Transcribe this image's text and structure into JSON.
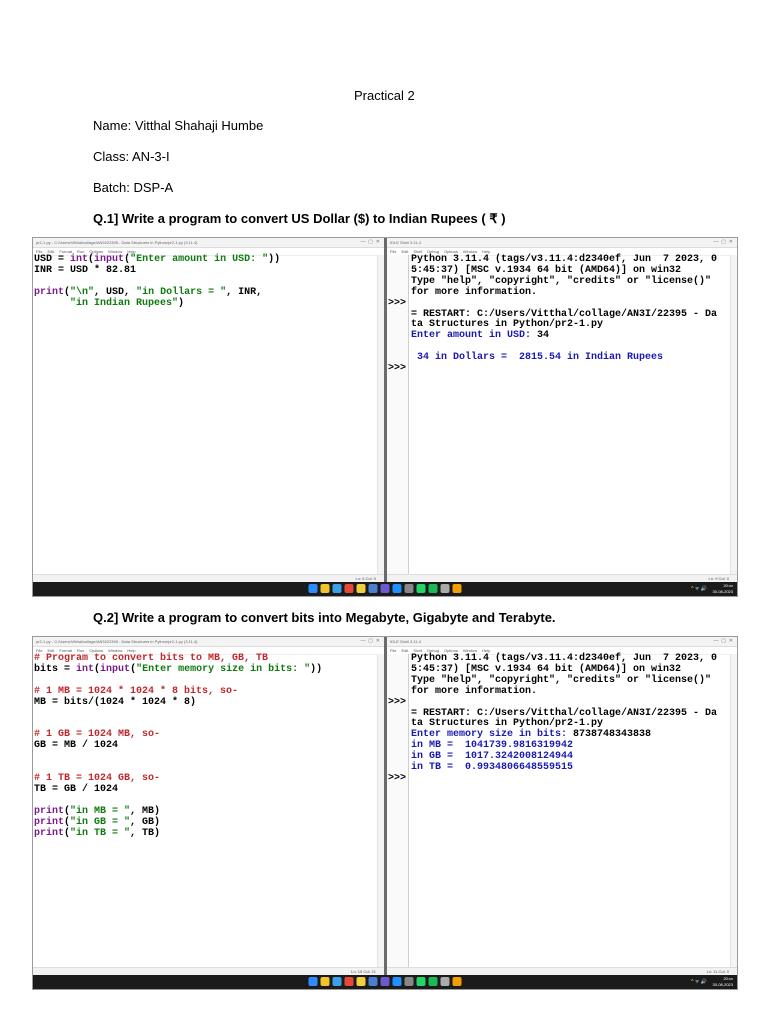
{
  "header": {
    "title": "Practical 2",
    "name_line": "Name: Vitthal Shahaji Humbe",
    "class_line": "Class: AN-3-I",
    "batch_line": "Batch: DSP-A"
  },
  "questions": [
    {
      "heading": "Q.1] Write a program to convert US Dollar ($) to Indian Rupees ( ₹ )",
      "editor": {
        "title": "pr2-1.py - C:/Users/Vitthal/collage/AN3I/22395 - Data Structures in Python/pr2-1.py (3.11.4)",
        "menu": [
          "File",
          "Edit",
          "Format",
          "Run",
          "Options",
          "Window",
          "Help"
        ],
        "status": "Ln: 6   Col: 0",
        "code": [
          "USD = int(input(\"Enter amount in USD: \"))",
          "INR = USD * 82.81",
          "",
          "print(\"\\n\", USD, \"in Dollars = \", INR,",
          "      \"in Indian Rupees\")"
        ]
      },
      "shell": {
        "title": "IDLE Shell 3.11.4",
        "menu": [
          "File",
          "Edit",
          "Shell",
          "Debug",
          "Options",
          "Window",
          "Help"
        ],
        "status": "Ln: 9   Col: 0",
        "gutter": [
          "",
          "",
          "",
          "",
          ">>>",
          "",
          "",
          "",
          "",
          "",
          ">>>"
        ],
        "info": [
          "Python 3.11.4 (tags/v3.11.4:d2340ef, Jun  7 2023, 0",
          "5:45:37) [MSC v.1934 64 bit (AMD64)] on win32",
          "Type \"help\", \"copyright\", \"credits\" or \"license()\"",
          "for more information."
        ],
        "restart": [
          "= RESTART: C:/Users/Vitthal/collage/AN3I/22395 - Da",
          "ta Structures in Python/pr2-1.py"
        ],
        "prompt": "Enter amount in USD: ",
        "input_value": "34",
        "output": " 34 in Dollars =  2815.54 in Indian Rupees"
      },
      "tray": {
        "lang": "ENG\nIN",
        "time": "20:xx\n30-08-2023"
      }
    },
    {
      "heading": "Q.2] Write a program to convert bits into Megabyte, Gigabyte and Terabyte.",
      "editor": {
        "title": "pr2-1.py - C:/Users/Vitthal/collage/AN3I/22395 - Data Structures in Python/pr2-1.py (3.11.4)",
        "menu": [
          "File",
          "Edit",
          "Format",
          "Run",
          "Options",
          "Window",
          "Help"
        ],
        "status": "Ln: 15   Col: 21",
        "code": [
          "# Program to convert bits to MB, GB, TB",
          "bits = int(input(\"Enter memory size in bits: \"))",
          "",
          "# 1 MB = 1024 * 1024 * 8 bits, so-",
          "MB = bits/(1024 * 1024 * 8)",
          "",
          "",
          "# 1 GB = 1024 MB, so-",
          "GB = MB / 1024",
          "",
          "",
          "# 1 TB = 1024 GB, so-",
          "TB = GB / 1024",
          "",
          "print(\"in MB = \", MB)",
          "print(\"in GB = \", GB)",
          "print(\"in TB = \", TB)"
        ]
      },
      "shell": {
        "title": "IDLE Shell 3.11.4",
        "menu": [
          "File",
          "Edit",
          "Shell",
          "Debug",
          "Options",
          "Window",
          "Help"
        ],
        "status": "Ln: 11   Col: 0",
        "gutter": [
          "",
          "",
          "",
          "",
          ">>>",
          "",
          "",
          "",
          "",
          "",
          "",
          ">>>"
        ],
        "info": [
          "Python 3.11.4 (tags/v3.11.4:d2340ef, Jun  7 2023, 0",
          "5:45:37) [MSC v.1934 64 bit (AMD64)] on win32",
          "Type \"help\", \"copyright\", \"credits\" or \"license()\"",
          "for more information."
        ],
        "restart": [
          "= RESTART: C:/Users/Vitthal/collage/AN3I/22395 - Da",
          "ta Structures in Python/pr2-1.py"
        ],
        "prompt": "Enter memory size in bits: ",
        "input_value": "8738748343838",
        "outputs": [
          "in MB =  1041739.9816319942",
          "in GB =  1017.3242008124944",
          "in TB =  0.9934806648559515"
        ]
      },
      "tray": {
        "lang": "ENG\nIN",
        "time": "20:xx\n30-08-2023"
      }
    }
  ],
  "colors": {
    "keyword": "#7a1c8a",
    "string": "#0f7a0f",
    "comment": "#c0282c",
    "shell_blue": "#1a1ab3",
    "taskbar": "#1b1b1b"
  },
  "taskbar_icons": [
    "windows-icon",
    "file-explorer-icon",
    "edge-icon",
    "chrome-icon",
    "idle-icon",
    "python-icon",
    "store-icon",
    "photos-icon",
    "terminal-icon",
    "whatsapp-icon",
    "spotify-icon",
    "settings-icon",
    "notes-icon"
  ]
}
